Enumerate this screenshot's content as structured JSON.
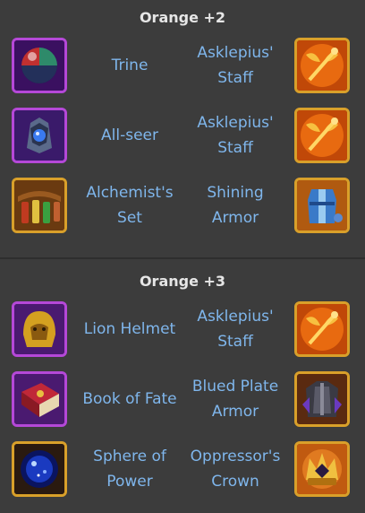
{
  "sections": [
    {
      "title": "Orange +2",
      "rows": [
        {
          "left_name": "Trine",
          "right_name": "Asklepius' Staff",
          "left_icon": "trine-orb-icon",
          "right_icon": "winged-staff-icon"
        },
        {
          "left_name": "All-seer",
          "right_name": "Asklepius' Staff",
          "left_icon": "all-seer-eye-icon",
          "right_icon": "winged-staff-icon"
        },
        {
          "left_name": "Alchemist's Set",
          "right_name": "Shining Armor",
          "left_icon": "potion-belt-icon",
          "right_icon": "blue-armor-icon"
        }
      ]
    },
    {
      "title": "Orange +3",
      "rows": [
        {
          "left_name": "Lion Helmet",
          "right_name": "Asklepius' Staff",
          "left_icon": "lion-helmet-icon",
          "right_icon": "winged-staff-icon"
        },
        {
          "left_name": "Book of Fate",
          "right_name": "Blued Plate Armor",
          "left_icon": "book-icon",
          "right_icon": "dark-plate-armor-icon"
        },
        {
          "left_name": "Sphere of Power",
          "right_name": "Oppressor's Crown",
          "left_icon": "blue-sphere-icon",
          "right_icon": "crown-icon"
        }
      ]
    }
  ],
  "colors": {
    "background": "#3c3c3c",
    "title": "#e6e6e6",
    "item_text": "#7fb6ec",
    "purple_frame": "#b548d8",
    "gold_frame": "#d9a02a"
  }
}
